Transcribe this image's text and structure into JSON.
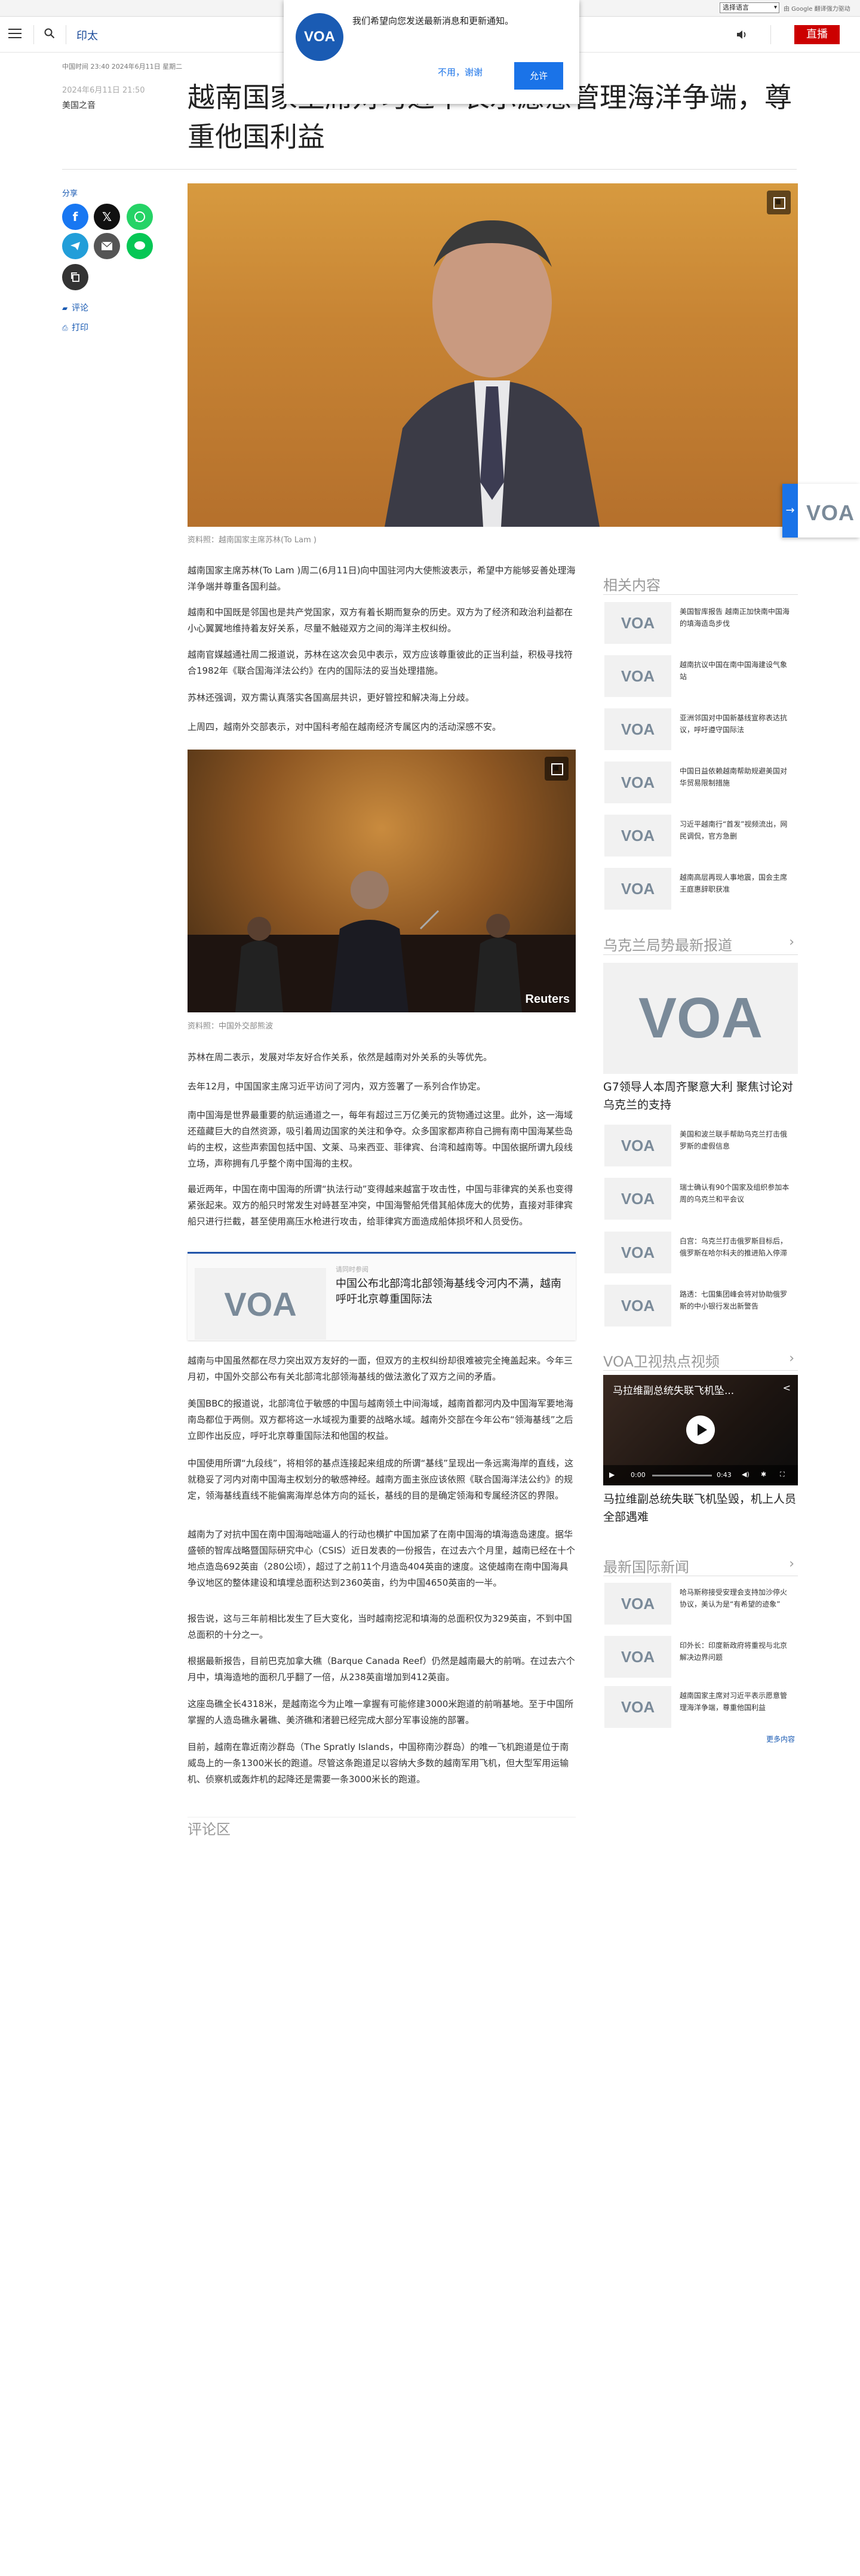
{
  "utility": {
    "language_select": "选择语言",
    "google_translate": "由 Google 翻译强力驱动"
  },
  "header": {
    "section": "印太",
    "live_label": "直播"
  },
  "notification": {
    "message": "我们希望向您发送最新消息和更新通知。",
    "decline_label": "不用，谢谢",
    "accept_label": "允许"
  },
  "article": {
    "dateline": "中国时间 23:40 2024年6月11日 星期二",
    "date": "2024年6月11日 21:50",
    "byline": "美国之音",
    "title": "越南国家主席对习近平表示愿意管理海洋争端，尊重他国利益",
    "share_label": "分享",
    "comment_label": "评论",
    "print_label": "打印",
    "hero_caption": "资料照：越南国家主席苏林(To Lam )",
    "paras_a": [
      "越南国家主席苏林(To Lam )周二(6月11日)向中国驻河内大使熊波表示，希望中方能够妥善处理海洋争端并尊重各国利益。",
      "越南和中国既是邻国也是共产党国家，双方有着长期而复杂的历史。双方为了经济和政治利益都在小心翼翼地维持着友好关系，尽量不触碰双方之间的海洋主权纠纷。",
      "越南官媒越通社周二报道说，苏林在这次会见中表示，双方应该尊重彼此的正当利益，积极寻找符合1982年《联合国海洋法公约》在内的国际法的妥当处理措施。",
      "苏林还强调，双方需认真落实各国高层共识，更好管控和解决海上分歧。",
      "上周四，越南外交部表示，对中国科考船在越南经济专属区内的活动深感不安。"
    ],
    "photo2_caption": "资料照：中国外交部熊波",
    "photo2_watermark": "Reuters",
    "paras_b": [
      "苏林在周二表示，发展对华友好合作关系，依然是越南对外关系的头等优先。",
      "去年12月，中国国家主席习近平访问了河内，双方签署了一系列合作协定。",
      "南中国海是世界最重要的航运通道之一，每年有超过三万亿美元的货物通过这里。此外，这一海域还蕴藏巨大的自然资源，吸引着周边国家的关注和争夺。众多国家都声称自己拥有南中国海某些岛屿的主权，这些声索国包括中国、文莱、马来西亚、菲律宾、台湾和越南等。中国依据所谓九段线立场，声称拥有几乎整个南中国海的主权。",
      "最近两年，中国在南中国海的所谓“执法行动”变得越来越富于攻击性，中国与菲律宾的关系也变得紧张起来。双方的船只时常发生对峙甚至冲突，中国海警船凭借其船体庞大的优势，直接对菲律宾船只进行拦截，甚至使用高压水枪进行攻击，给菲律宾方面造成船体损坏和人员受伤。"
    ],
    "related": {
      "label": "请同时参阅",
      "title": "中国公布北部湾北部领海基线令河内不满，越南呼吁北京尊重国际法"
    },
    "paras_c": [
      "越南与中国虽然都在尽力突出双方友好的一面，但双方的主权纠纷却很难被完全掩盖起来。今年三月初，中国外交部公布有关北部湾北部领海基线的做法激化了双方之间的矛盾。",
      "美国BBC的报道说，北部湾位于敏感的中国与越南领土中间海域，越南首都河内及中国海军要地海南岛都位于两侧。双方都将这一水域视为重要的战略水域。越南外交部在今年公布“领海基线”之后立即作出反应，呼吁北京尊重国际法和他国的权益。",
      "中国使用所谓“九段线”，将相邻的基点连接起来组成的所谓“基线”呈现出一条远离海岸的直线，这就稳妥了河内对南中国海主权划分的敏感神经。越南方面主张应该依照《联合国海洋法公约》的规定，领海基线直线不能偏离海岸总体方向的延长，基线的目的是确定领海和专属经济区的界限。",
      "越南为了对抗中国在南中国海咄咄逼人的行动也横扩中国加紧了在南中国海的填海造岛速度。据华盛顿的智库战略暨国际研究中心（CSIS）近日发表的一份报告，在过去六个月里，越南已经在十个地点造岛692英亩（280公顷），超过了之前11个月造岛404英亩的速度。这使越南在南中国海具争议地区的整体建设和填埋总面积达到2360英亩，约为中国4650英亩的一半。",
      "报告说，这与三年前相比发生了巨大变化，当时越南挖泥和填海的总面积仅为329英亩，不到中国总面积的十分之一。",
      "根据最新报告，目前巴克加拿大礁（Barque Canada Reef）仍然是越南最大的前哨。在过去六个月中，填海造地的面积几乎翻了一倍，从238英亩增加到412英亩。",
      "这座岛礁全长4318米，是越南迄今为止唯一拿握有可能修建3000米跑道的前哨基地。至于中国所掌握的人造岛礁永暑礁、美济礁和渚碧已经完成大部分军事设施的部署。",
      "目前，越南在靠近南沙群岛（The Spratly Islands，中国称南沙群岛）的唯一飞机跑道是位于南威岛上的一条1300米长的跑道。尽管这条跑道足以容纳大多数的越南军用飞机，但大型军用运输机、侦察机或轰炸机的起降还是需要一条3000米长的跑道。"
    ],
    "comments_heading": "评论区"
  },
  "sidebar": {
    "related_heading": "相关内容",
    "related_items": [
      "美国智库报告 越南正加快南中国海的填海造岛步伐",
      "越南抗议中国在南中国海建设气象站",
      "亚洲邻国对中国新基线宣称表达抗议，呼吁遵守国际法",
      "中国日益依赖越南帮助规避美国对华贸易限制措施",
      "习近平越南行“首发”视频流出，网民调侃，官方急删",
      "越南高层再现人事地震，国会主席王庭惠辞职获准"
    ],
    "ukraine_heading": "乌克兰局势最新报道",
    "ukraine_feature_title": "G7领导人本周齐聚意大利 聚焦讨论对乌克兰的支持",
    "ukraine_items": [
      "美国和波兰联手帮助乌克兰打击俄罗斯的虚假信息",
      "瑞士确认有90个国家及组织参加本周的乌克兰和平会议",
      "白宫：乌克兰打击俄罗斯目标后，俄罗斯在哈尔科夫的推进陷入停滞",
      "路透：七国集团峰会将对协助俄罗斯的中小银行发出新警告"
    ],
    "video_heading": "VOA卫视热点视频",
    "video_title": "马拉维副总统失联飞机坠...",
    "video_time": "0:00",
    "video_duration": "0:43",
    "video_caption": "马拉维副总统失联飞机坠毁，机上人员全部遇难",
    "intl_heading": "最新国际新闻",
    "intl_items": [
      "哈马斯称接受安理会支持加沙停火协议，美认为是“有希望的迹象”",
      "印外长：印度新政府将重视与北京解决边界问题",
      "越南国家主席对习近平表示愿意管理海洋争端，尊重他国利益"
    ],
    "more_label": "更多内容"
  }
}
